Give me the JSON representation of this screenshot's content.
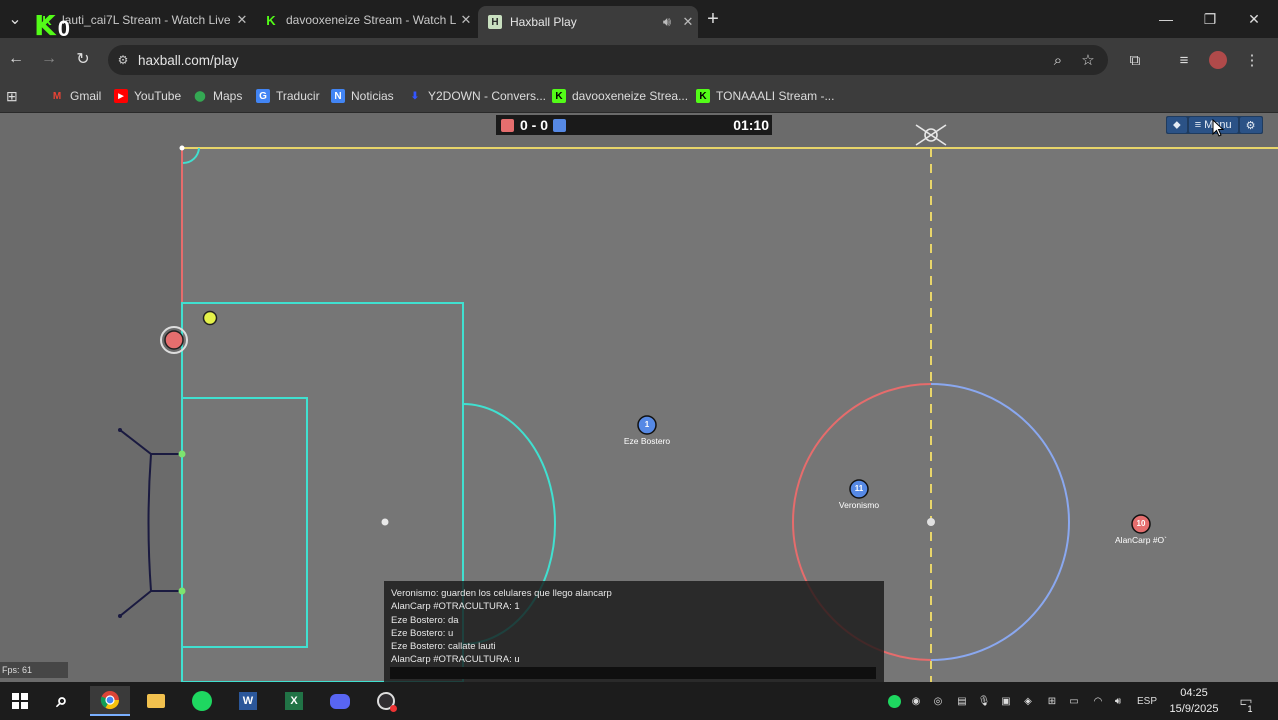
{
  "browser": {
    "tabs": [
      {
        "title": "lauti_cai7L Stream - Watch Live",
        "favicon": "kick-icon"
      },
      {
        "title": "davooxeneize Stream - Watch L",
        "favicon": "kick-icon"
      },
      {
        "title": "Haxball Play",
        "favicon": "haxball-icon",
        "active": true
      }
    ],
    "overlay_counter": "0",
    "address": "haxball.com/play",
    "bookmarks": [
      {
        "label": "Gmail",
        "icon": "gmail-icon",
        "color": "#ea4335"
      },
      {
        "label": "YouTube",
        "icon": "youtube-icon",
        "color": "#ff0000"
      },
      {
        "label": "Maps",
        "icon": "maps-icon",
        "color": "#34a853"
      },
      {
        "label": "Traducir",
        "icon": "translate-icon",
        "color": "#4285f4"
      },
      {
        "label": "Noticias",
        "icon": "news-icon",
        "color": "#4285f4"
      },
      {
        "label": "Y2DOWN - Convers...",
        "icon": "y2down-icon",
        "color": "#3355ff"
      },
      {
        "label": "davooxeneize Strea...",
        "icon": "kick-icon",
        "color": "#53fc18"
      },
      {
        "label": "TONAAALI Stream -...",
        "icon": "kick-icon",
        "color": "#53fc18"
      }
    ]
  },
  "game": {
    "score": "0 - 0",
    "time": "01:10",
    "menu_label": "Menu",
    "fps": "Fps: 61",
    "team_colors": {
      "red": "#e56e6e",
      "blue": "#5689e5"
    },
    "players": [
      {
        "number": "1",
        "name": "Eze Bostero",
        "team": "blue"
      },
      {
        "number": "11",
        "name": "Veronismo",
        "team": "blue"
      },
      {
        "number": "10",
        "name": "AlanCarp #O`",
        "team": "red"
      },
      {
        "number": "",
        "name": "",
        "team": "red",
        "controlled": true
      }
    ],
    "chat": [
      "Veronismo: guarden los celulares que llego alancarp",
      "AlanCarp #OTRACULTURA: 1",
      "Eze Bostero: da",
      "Eze Bostero: u",
      "Eze Bostero: callate lauti",
      "AlanCarp #OTRACULTURA: u"
    ]
  },
  "taskbar": {
    "language": "ESP",
    "time": "04:25",
    "date": "15/9/2025",
    "notifications": "1"
  }
}
